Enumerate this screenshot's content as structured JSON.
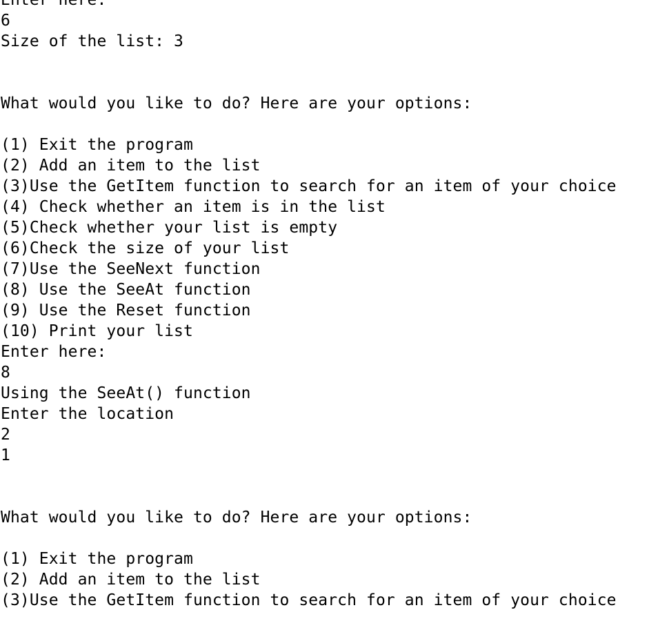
{
  "console": {
    "lines": [
      "Enter here:",
      "6",
      "Size of the list: 3",
      "",
      "",
      "What would you like to do? Here are your options:",
      "",
      "(1) Exit the program",
      "(2) Add an item to the list",
      "(3)Use the GetItem function to search for an item of your choice",
      "(4) Check whether an item is in the list",
      "(5)Check whether your list is empty",
      "(6)Check the size of your list",
      "(7)Use the SeeNext function",
      "(8) Use the SeeAt function",
      "(9) Use the Reset function",
      "(10) Print your list",
      "Enter here:",
      "8",
      "Using the SeeAt() function",
      "Enter the location",
      "2",
      "1",
      "",
      "",
      "What would you like to do? Here are your options:",
      "",
      "(1) Exit the program",
      "(2) Add an item to the list",
      "(3)Use the GetItem function to search for an item of your choice"
    ]
  }
}
